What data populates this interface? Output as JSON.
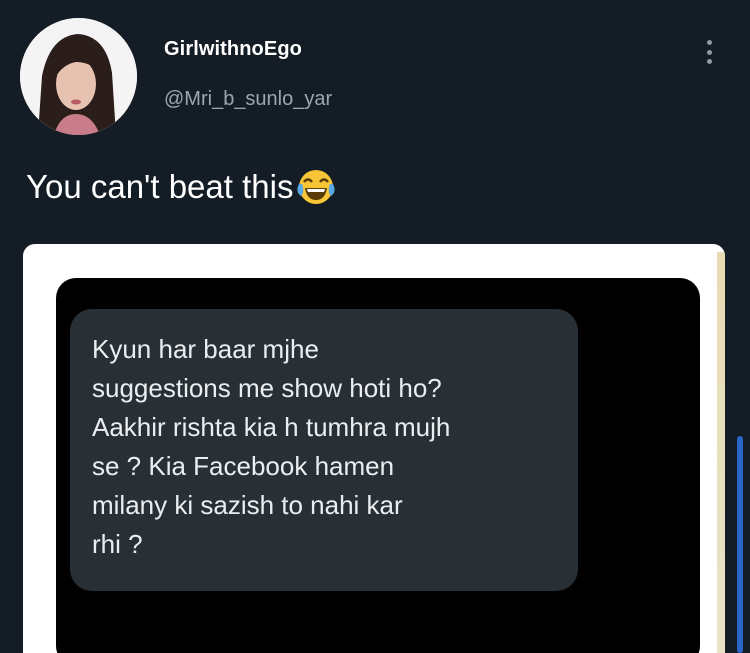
{
  "user": {
    "display_name": "GirlwithnoEgo",
    "handle": "@Mri_b_sunlo_yar"
  },
  "tweet": {
    "text": "You can't beat this",
    "emoji": "face-with-tears-of-joy-icon"
  },
  "media": {
    "message_lines": [
      "Kyun har baar mjhe",
      "suggestions me show hoti ho?",
      "Aakhir rishta kia h tumhra mujh",
      "se ? Kia Facebook hamen",
      "milany ki sazish to nahi kar",
      "rhi ?"
    ]
  },
  "colors": {
    "background": "#141d26",
    "handle": "#9aa7b3",
    "bubble": "#283036",
    "scrollbar": "#2a65c9"
  }
}
